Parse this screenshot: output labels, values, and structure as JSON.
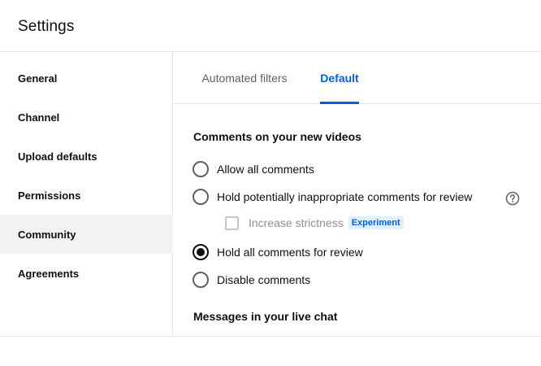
{
  "header": {
    "title": "Settings"
  },
  "sidebar": {
    "items": [
      {
        "label": "General"
      },
      {
        "label": "Channel"
      },
      {
        "label": "Upload defaults"
      },
      {
        "label": "Permissions"
      },
      {
        "label": "Community",
        "active": true
      },
      {
        "label": "Agreements"
      }
    ]
  },
  "tabs": [
    {
      "label": "Automated filters"
    },
    {
      "label": "Default",
      "active": true
    }
  ],
  "comments_section": {
    "heading": "Comments on your new videos",
    "options": [
      {
        "label": "Allow all comments",
        "selected": false
      },
      {
        "label": "Hold potentially inappropriate comments for review",
        "selected": false
      },
      {
        "label": "Hold all comments for review",
        "selected": true
      },
      {
        "label": "Disable comments",
        "selected": false
      }
    ],
    "strictness": {
      "label": "Increase strictness",
      "checked": false,
      "badge": "Experiment"
    }
  },
  "live_chat_section": {
    "heading": "Messages in your live chat"
  },
  "icons": {
    "help": "help-circle-icon"
  },
  "colors": {
    "accent": "#065fd4",
    "badge_bg": "#def1ff",
    "active_nav_bg": "#f2f2f2"
  }
}
